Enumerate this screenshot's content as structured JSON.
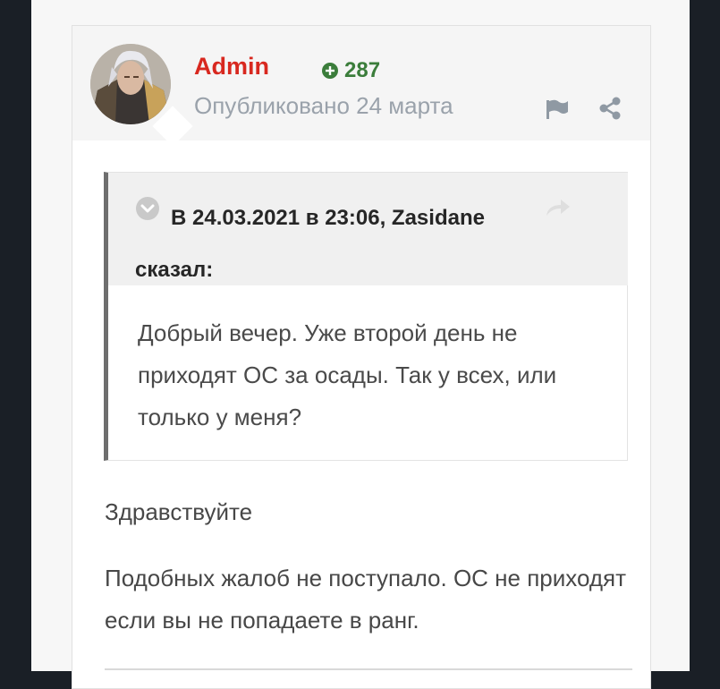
{
  "post": {
    "author": "Admin",
    "reputation": "287",
    "published": "Опубликовано 24 марта",
    "icons": {
      "reputation": "plus-circle-icon",
      "report": "flag-icon",
      "share": "share-icon"
    },
    "colors": {
      "author": "#d8281f",
      "reputation": "#3b7d3b"
    }
  },
  "quote": {
    "citation": "В 24.03.2021 в 23:06, Zasidane сказал:",
    "icons": {
      "toggle": "chevron-down-icon",
      "goto": "reply-arrow-icon"
    },
    "text": "Добрый вечер. Уже второй день не приходят ОС за осады. Так у всех, или только у меня?"
  },
  "body": {
    "paragraphs": [
      "Здравствуйте",
      "Подобных жалоб не поступало. ОС не приходят если вы не попадаете в ранг."
    ]
  }
}
